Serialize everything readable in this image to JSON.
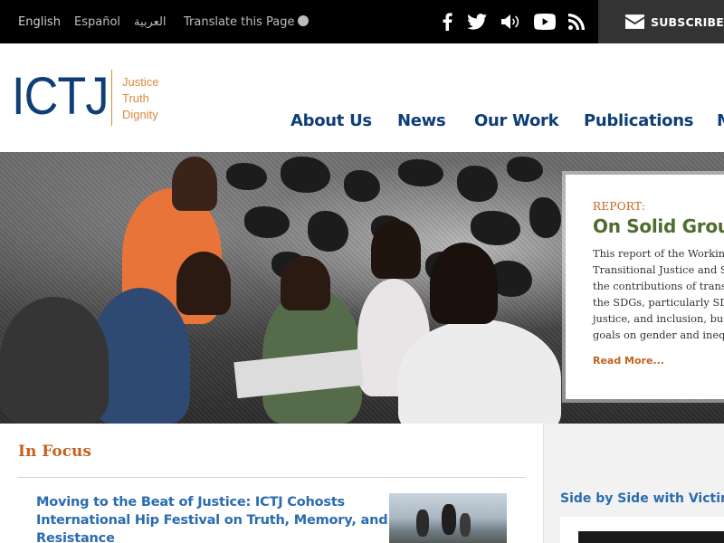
{
  "topbar": {
    "languages": [
      {
        "label": "English"
      },
      {
        "label": "Español"
      },
      {
        "label": "العربية"
      }
    ],
    "translate_label": "Translate this Page",
    "social_icons": [
      "facebook-icon",
      "twitter-icon",
      "audio-icon",
      "youtube-icon",
      "rss-icon"
    ],
    "subscribe_label": "SUBSCRIBE"
  },
  "logo": {
    "wordmark": "ICTJ",
    "taglines": [
      "Justice",
      "Truth",
      "Dignity"
    ]
  },
  "nav": {
    "items": [
      {
        "label": "About Us"
      },
      {
        "label": "News"
      },
      {
        "label": "Our Work"
      },
      {
        "label": "Publications"
      },
      {
        "label": "M"
      }
    ]
  },
  "hero": {
    "kicker": "REPORT:",
    "title": "On Solid Grou",
    "body_lines": [
      "This report of the Working",
      "Transitional Justice and S",
      "the contributions of trans",
      "the SDGs, particularly SD",
      "justice, and inclusion, bu",
      "goals on gender and inequ"
    ],
    "read_more": "Read More..."
  },
  "in_focus": {
    "heading": "In Focus",
    "article_title_lines": [
      "Moving to the Beat of Justice: ICTJ Cohosts",
      "International Hip Festival on Truth, Memory, and",
      "Resistance"
    ]
  },
  "sidebar": {
    "title": "Side by Side with Victims"
  },
  "colors": {
    "navy": "#0f3e76",
    "orange": "#c4621d",
    "link_blue": "#2a6cb0",
    "green": "#4f6d2e"
  }
}
